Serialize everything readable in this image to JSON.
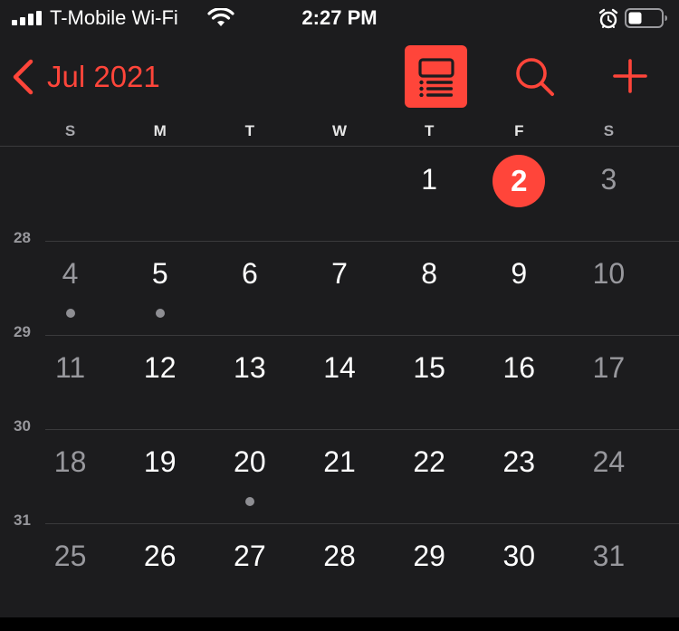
{
  "status_bar": {
    "carrier": "T-Mobile Wi-Fi",
    "time": "2:27 PM",
    "icons": [
      "signal-icon",
      "wifi-icon",
      "alarm-icon",
      "battery-icon"
    ]
  },
  "nav": {
    "back_label": "Jul 2021",
    "buttons": [
      "list-view-button",
      "search-button",
      "add-event-button"
    ],
    "accent_color": "#ff453a"
  },
  "weekdays": [
    "S",
    "M",
    "T",
    "W",
    "T",
    "F",
    "S"
  ],
  "weeks": [
    {
      "week_label": "",
      "days": [
        "",
        "",
        "",
        "",
        "1",
        "2",
        "3"
      ],
      "dots": [
        false,
        false,
        false,
        false,
        false,
        false,
        false
      ]
    },
    {
      "week_label": "28",
      "days": [
        "4",
        "5",
        "6",
        "7",
        "8",
        "9",
        "10"
      ],
      "dots": [
        true,
        true,
        false,
        false,
        false,
        false,
        false
      ]
    },
    {
      "week_label": "29",
      "days": [
        "11",
        "12",
        "13",
        "14",
        "15",
        "16",
        "17"
      ],
      "dots": [
        false,
        false,
        false,
        false,
        false,
        false,
        false
      ]
    },
    {
      "week_label": "30",
      "days": [
        "18",
        "19",
        "20",
        "21",
        "22",
        "23",
        "24"
      ],
      "dots": [
        false,
        false,
        true,
        false,
        false,
        false,
        false
      ]
    },
    {
      "week_label": "31",
      "days": [
        "25",
        "26",
        "27",
        "28",
        "29",
        "30",
        "31"
      ],
      "dots": [
        false,
        false,
        false,
        false,
        false,
        false,
        false
      ]
    }
  ],
  "today": "2"
}
